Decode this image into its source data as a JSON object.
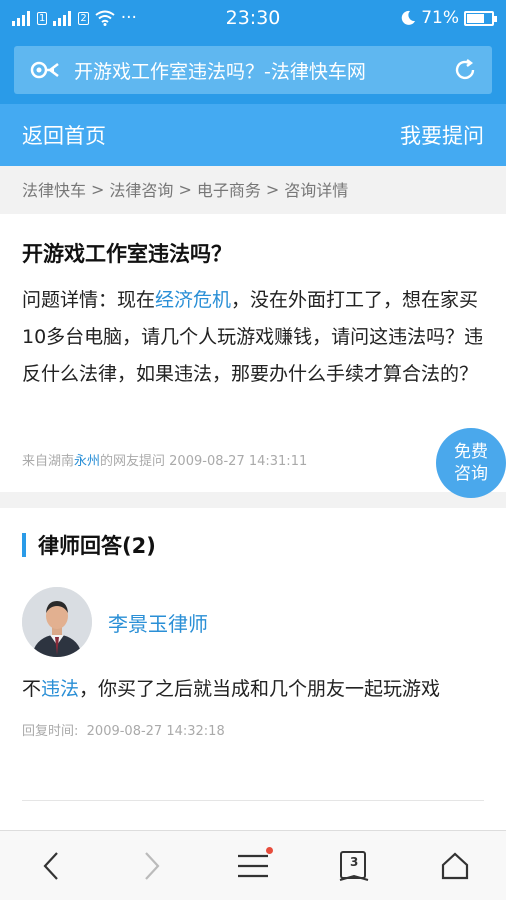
{
  "status": {
    "time": "23:30",
    "sim1": "1",
    "sim2": "2",
    "battery_text": "71%",
    "battery_level": 0.71,
    "more": "···"
  },
  "browser": {
    "page_title": "开游戏工作室违法吗？-法律快车网"
  },
  "nav": {
    "home": "返回首页",
    "ask": "我要提问"
  },
  "breadcrumb": [
    "法律快车",
    "法律咨询",
    "电子商务",
    "咨询详情"
  ],
  "breadcrumb_sep": ">",
  "question": {
    "title": "开游戏工作室违法吗？",
    "body_prefix": "问题详情：现在",
    "body_link": "经济危机",
    "body_rest": "，没在外面打工了，想在家买10多台电脑，请几个人玩游戏赚钱，请问这违法吗？违反什么法律，如果违法，那要办什么手续才算合法的？",
    "meta_prefix": "来自湖南",
    "meta_city": "永州",
    "meta_suffix": "的网友提问 2009-08-27 14:31:11"
  },
  "free_consult": {
    "line1": "免费",
    "line2": "咨询"
  },
  "answers": {
    "heading": "律师回答(2)",
    "items": [
      {
        "lawyer": "李景玉律师",
        "body_prefix": "不",
        "body_link": "违法",
        "body_rest": "，你买了之后就当成和几个朋友一起玩游戏",
        "time_label": "回复时间:",
        "time": "2009-08-27 14:32:18"
      }
    ]
  },
  "toolbar": {
    "tabs_count": "3"
  },
  "colors": {
    "brand": "#2a9be8",
    "link": "#2a8fd6"
  }
}
